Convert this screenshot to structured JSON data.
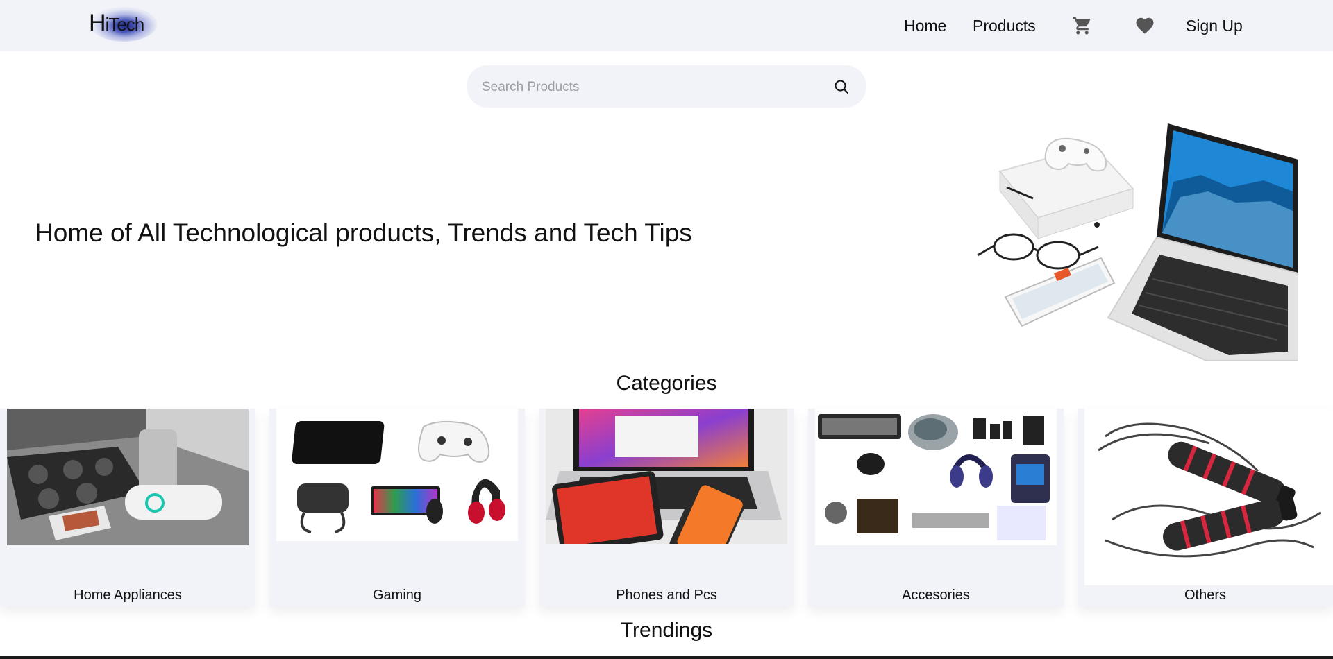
{
  "header": {
    "logo": {
      "big": "H",
      "small": "iTech"
    },
    "nav": {
      "home": "Home",
      "products": "Products",
      "signup": "Sign Up"
    },
    "icons": {
      "cart": "cart-icon",
      "wishlist": "heart-icon"
    }
  },
  "search": {
    "placeholder": "Search Products",
    "value": ""
  },
  "hero": {
    "title": "Home of All Technological products, Trends and Tech Tips"
  },
  "categories": {
    "title": "Categories",
    "items": [
      {
        "label": "Home Appliances"
      },
      {
        "label": "Gaming"
      },
      {
        "label": "Phones and Pcs"
      },
      {
        "label": "Accesories"
      },
      {
        "label": "Others"
      }
    ]
  },
  "trending": {
    "title": "Trendings"
  },
  "colors": {
    "header_bg": "#f1f3f8",
    "card_bg": "#f1f3f8",
    "text": "#111111",
    "accent_red": "#d7263d"
  }
}
